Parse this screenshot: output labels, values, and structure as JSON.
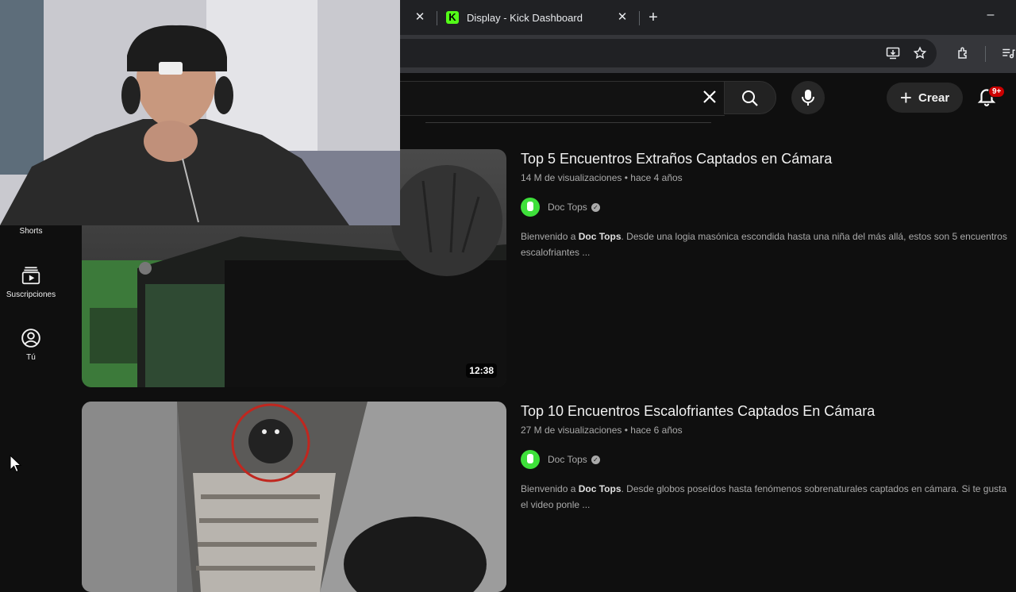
{
  "browser": {
    "tabs": [
      {
        "title": "Display - Kick Dashboard"
      }
    ],
    "new_tab_symbol": "+",
    "minimize_symbol": "–"
  },
  "header": {
    "create_label": "Crear",
    "notification_badge": "9+"
  },
  "sidebar": {
    "items": [
      {
        "label": "Shorts",
        "icon": "shorts-icon"
      },
      {
        "label": "Suscripciones",
        "icon": "subscriptions-icon"
      },
      {
        "label": "Tú",
        "icon": "account-icon"
      }
    ]
  },
  "results": [
    {
      "title": "Top 5 Encuentros Extraños Captados en Cámara",
      "views": "14 M de visualizaciones",
      "age": "hace 4 años",
      "channel": "Doc Tops",
      "duration": "12:38",
      "desc_prefix": "Bienvenido a ",
      "desc_bold": "Doc Tops",
      "desc_rest": ". Desde una logia masónica escondida hasta una niña del más allá, estos son 5 encuentros escalofriantes ..."
    },
    {
      "title": "Top 10 Encuentros Escalofriantes Captados En Cámara",
      "views": "27 M de visualizaciones",
      "age": "hace 6 años",
      "channel": "Doc Tops",
      "desc_prefix": "Bienvenido a ",
      "desc_bold": "Doc Tops",
      "desc_rest": ". Desde globos poseídos hasta fenómenos sobrenaturales captados en cámara. Si te gusta el video ponle ..."
    }
  ],
  "colors": {
    "background": "#0f0f0f",
    "kick_green": "#53fc18",
    "badge_red": "#cc0000"
  }
}
